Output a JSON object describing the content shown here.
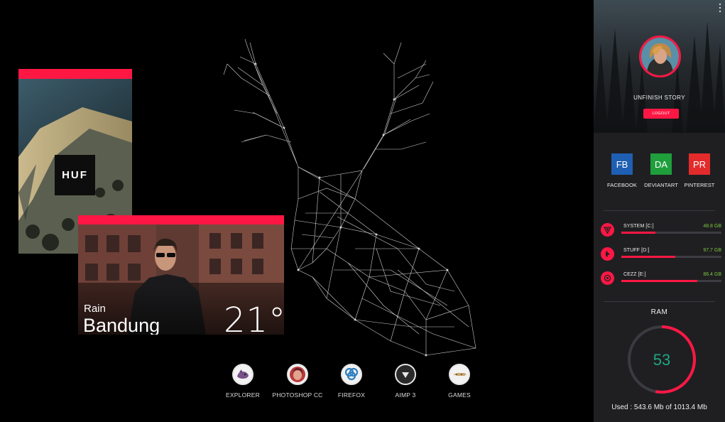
{
  "weather": {
    "condition": "Rain",
    "city": "Bandung",
    "temperature": "21°"
  },
  "huf_card": {
    "logo_text": "HUF"
  },
  "dock": [
    {
      "label": "EXPLORER",
      "icon": "explorer-icon"
    },
    {
      "label": "PHOTOSHOP CC",
      "icon": "photoshop-icon"
    },
    {
      "label": "FIREFOX",
      "icon": "firefox-icon"
    },
    {
      "label": "AIMP 3",
      "icon": "aimp-icon"
    },
    {
      "label": "GAMES",
      "icon": "games-icon"
    }
  ],
  "profile": {
    "username": "UNFINISH STORY",
    "logout_label": "LOGOUT"
  },
  "social": [
    {
      "abbr": "FB",
      "label": "FACEBOOK",
      "color": "#1e5fb3"
    },
    {
      "abbr": "DA",
      "label": "DEVIANTART",
      "color": "#1f9e3c"
    },
    {
      "abbr": "PR",
      "label": "PINTEREST",
      "color": "#e32b2b"
    }
  ],
  "drives": [
    {
      "name": "SYSTEM [C:]",
      "free": "48.8 GB",
      "used_fraction": 0.34
    },
    {
      "name": "STUFF [D:]",
      "free": "97.7 GB",
      "used_fraction": 0.54
    },
    {
      "name": "CEZZ [E:]",
      "free": "86.4 GB",
      "used_fraction": 0.76
    }
  ],
  "ram": {
    "title": "RAM",
    "percent": 53,
    "percent_text": "53",
    "usage_text": "Used : 543.6 Mb  of  1013.4 Mb"
  },
  "colors": {
    "accent": "#ff1744",
    "drive_value": "#7dc63d",
    "ram_number": "#1fa77c"
  }
}
